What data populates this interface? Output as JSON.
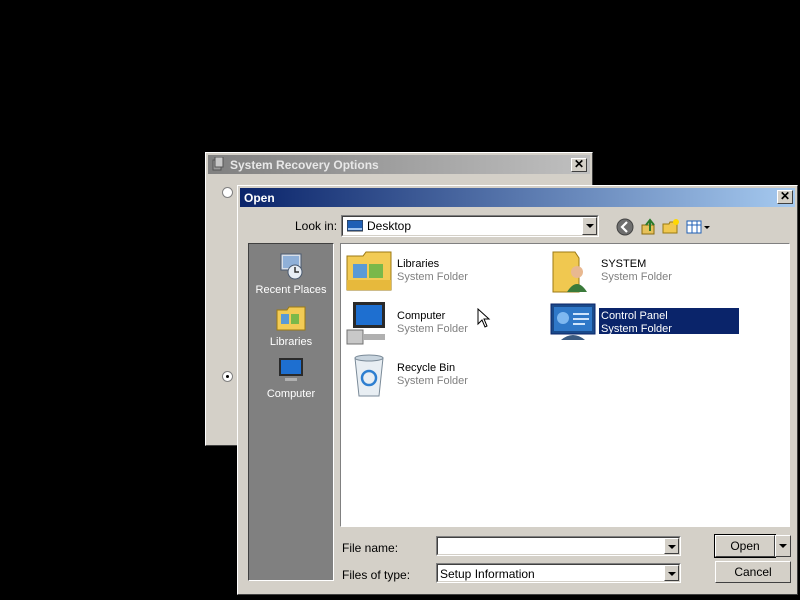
{
  "background_window": {
    "title": "System Recovery Options",
    "close_glyph": "✕"
  },
  "dialog": {
    "title": "Open",
    "close_glyph": "✕",
    "look_in_label": "Look in:",
    "look_in_value": "Desktop",
    "toolbar": [
      "back-icon",
      "up-folder-icon",
      "new-folder-icon",
      "view-menu-icon"
    ],
    "places": [
      {
        "label": "Recent Places",
        "icon": "recent-places-icon"
      },
      {
        "label": "Libraries",
        "icon": "libraries-icon"
      },
      {
        "label": "Computer",
        "icon": "computer-icon"
      }
    ],
    "items": [
      {
        "name": "Libraries",
        "type": "System Folder",
        "icon": "libraries-folder-icon",
        "selected": false
      },
      {
        "name": "SYSTEM",
        "type": "System Folder",
        "icon": "user-folder-icon",
        "selected": false
      },
      {
        "name": "Computer",
        "type": "System Folder",
        "icon": "computer-icon",
        "selected": false
      },
      {
        "name": "Control Panel",
        "type": "System Folder",
        "icon": "control-panel-icon",
        "selected": true
      },
      {
        "name": "Recycle Bin",
        "type": "System Folder",
        "icon": "recycle-bin-icon",
        "selected": false
      }
    ],
    "file_name_label": "File name:",
    "file_name_value": "",
    "files_of_type_label": "Files of type:",
    "files_of_type_value": "Setup Information",
    "open_label": "Open",
    "cancel_label": "Cancel"
  },
  "colors": {
    "selection": "#0a246a",
    "title_active": "#0a246a",
    "face": "#d4d0c8"
  }
}
